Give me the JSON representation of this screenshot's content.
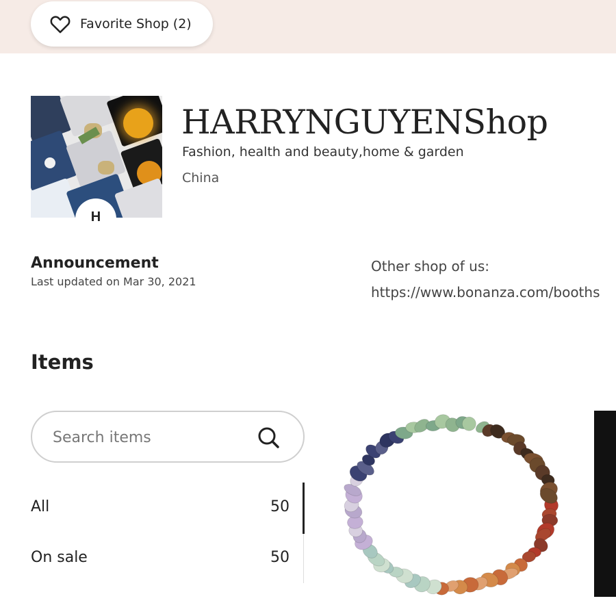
{
  "header": {
    "favorite_label": "Favorite Shop (2)"
  },
  "shop": {
    "name": "HARRYNGUYENShop",
    "tagline": "Fashion, health and beauty,home & garden",
    "location": "China",
    "avatar_letter": "H"
  },
  "announcement": {
    "title": "Announcement",
    "updated": "Last updated on Mar 30, 2021",
    "text_line1": "Other shop of us:",
    "text_line2": "https://www.bonanza.com/booths"
  },
  "items": {
    "heading": "Items",
    "search_placeholder": "Search items",
    "filters": [
      {
        "label": "All",
        "count": "50"
      },
      {
        "label": "On sale",
        "count": "50"
      }
    ]
  },
  "colors": {
    "banner": "#f6ebe6",
    "text": "#222222"
  },
  "icons": [
    "heart-icon",
    "search-icon"
  ]
}
